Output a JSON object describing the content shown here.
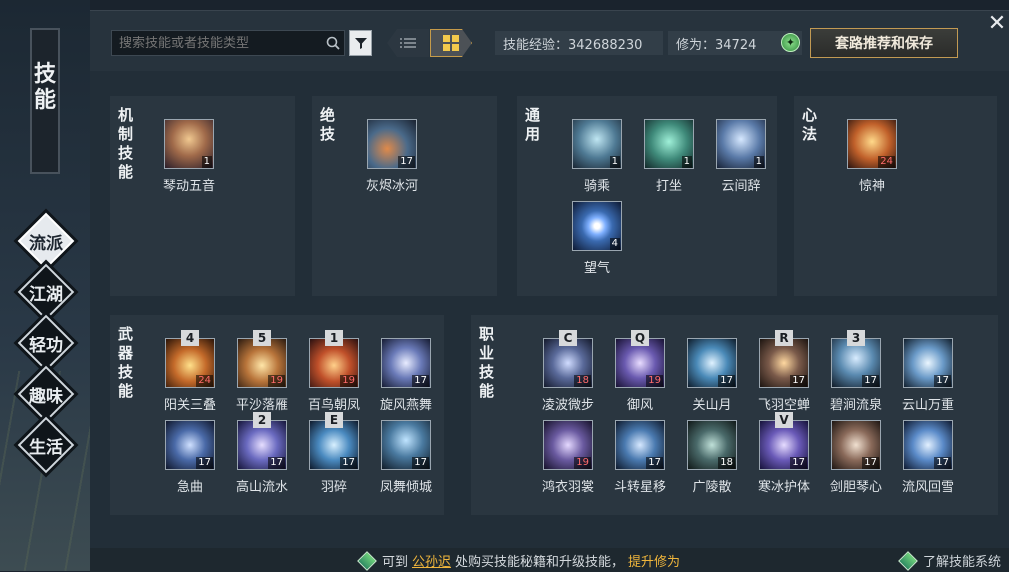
{
  "sidebar": {
    "title_chars": [
      "技",
      "能"
    ],
    "items": [
      {
        "label": "流派",
        "active": true
      },
      {
        "label": "江湖",
        "active": false
      },
      {
        "label": "轻功",
        "active": false
      },
      {
        "label": "趣味",
        "active": false
      },
      {
        "label": "生活",
        "active": false
      }
    ]
  },
  "toolbar": {
    "search_placeholder": "搜索技能或者技能类型",
    "skill_exp": "技能经验：342688230",
    "cultivation": "修为：34724",
    "recommend_button": "套路推荐和保存"
  },
  "panels": {
    "mechanism": {
      "label": [
        "机",
        "制",
        "技",
        "能"
      ],
      "skills": [
        {
          "name": "琴动五音",
          "level": "1",
          "icon": "music-orb-icon",
          "color": "#a06a4a"
        }
      ]
    },
    "ultimate": {
      "label": [
        "绝",
        "技"
      ],
      "skills": [
        {
          "name": "灰烬冰河",
          "level": "17",
          "icon": "ember-glacier-icon",
          "color": "#4a6a8a"
        }
      ]
    },
    "common": {
      "label": [
        "通",
        "用"
      ],
      "skills": [
        {
          "name": "骑乘",
          "level": "1",
          "icon": "horse-icon",
          "color": "#4f7a94"
        },
        {
          "name": "打坐",
          "level": "1",
          "icon": "meditate-icon",
          "color": "#3f8a7a"
        },
        {
          "name": "云间辞",
          "level": "1",
          "icon": "cloud-sword-icon",
          "color": "#5a7aa8"
        },
        {
          "name": "望气",
          "level": "4",
          "icon": "eye-qi-icon",
          "color": "#3a6ab0"
        }
      ]
    },
    "mind": {
      "label": [
        "心",
        "法"
      ],
      "skills": [
        {
          "name": "惊神",
          "level": "24",
          "icon": "phoenix-icon",
          "color": "#c0602a",
          "red": true
        }
      ]
    },
    "weapon": {
      "label": [
        "武",
        "器",
        "技",
        "能"
      ],
      "skills": [
        {
          "name": "阳关三叠",
          "level": "24",
          "key": "4",
          "icon": "flame-icon",
          "color": "#c46a2a",
          "red": true
        },
        {
          "name": "平沙落雁",
          "level": "19",
          "key": "5",
          "icon": "sand-burst-icon",
          "color": "#b8743a",
          "red": true
        },
        {
          "name": "百鸟朝凤",
          "level": "19",
          "key": "1",
          "icon": "phoenix-wing-icon",
          "color": "#c0502a",
          "red": true
        },
        {
          "name": "旋风燕舞",
          "level": "17",
          "key": "",
          "icon": "whirlwind-icon",
          "color": "#6a7ab8"
        },
        {
          "name": "急曲",
          "level": "17",
          "key": "",
          "icon": "rapid-tune-icon",
          "color": "#4a6aa8"
        },
        {
          "name": "高山流水",
          "level": "17",
          "key": "2",
          "icon": "mountain-water-icon",
          "color": "#6a6ac0"
        },
        {
          "name": "羽碎",
          "level": "17",
          "key": "E",
          "icon": "feather-shatter-icon",
          "color": "#4a8ac0"
        },
        {
          "name": "凤舞倾城",
          "level": "17",
          "key": "",
          "icon": "phoenix-dance-icon",
          "color": "#4a7aa0"
        }
      ]
    },
    "profession": {
      "label": [
        "职",
        "业",
        "技",
        "能"
      ],
      "skills": [
        {
          "name": "凌波微步",
          "level": "18",
          "key": "C",
          "icon": "wave-step-icon",
          "color": "#5a6a9a",
          "red": true
        },
        {
          "name": "御风",
          "level": "19",
          "key": "Q",
          "icon": "wind-ride-icon",
          "color": "#6a5ab0",
          "red": true
        },
        {
          "name": "关山月",
          "level": "17",
          "key": "",
          "icon": "moon-vortex-icon",
          "color": "#4a8ab8"
        },
        {
          "name": "飞羽空蝉",
          "level": "17",
          "key": "R",
          "icon": "cicada-icon",
          "color": "#7a5a4a"
        },
        {
          "name": "碧涧流泉",
          "level": "17",
          "key": "3",
          "icon": "spring-icon",
          "color": "#5a8ab0"
        },
        {
          "name": "云山万重",
          "level": "17",
          "key": "",
          "icon": "ice-peak-icon",
          "color": "#6a9ac8"
        },
        {
          "name": "鸿衣羽裳",
          "level": "19",
          "key": "",
          "icon": "feather-robe-icon",
          "color": "#6a5aa0",
          "red": true
        },
        {
          "name": "斗转星移",
          "level": "17",
          "key": "",
          "icon": "star-shift-icon",
          "color": "#4a7ab0"
        },
        {
          "name": "广陵散",
          "level": "18",
          "key": "",
          "icon": "guangling-icon",
          "color": "#4a6a6a"
        },
        {
          "name": "寒冰护体",
          "level": "17",
          "key": "V",
          "icon": "ice-shield-icon",
          "color": "#6a5ab8"
        },
        {
          "name": "剑胆琴心",
          "level": "17",
          "key": "",
          "icon": "sword-qin-icon",
          "color": "#8a6a5a"
        },
        {
          "name": "流风回雪",
          "level": "17",
          "key": "",
          "icon": "wind-snow-icon",
          "color": "#5a8ac8"
        }
      ]
    }
  },
  "footer": {
    "tip_prefix": "可到",
    "tip_link": "公孙迟",
    "tip_middle": "处购买技能秘籍和升级技能，",
    "tip_action": "提升修为",
    "help_link": "了解技能系统"
  }
}
